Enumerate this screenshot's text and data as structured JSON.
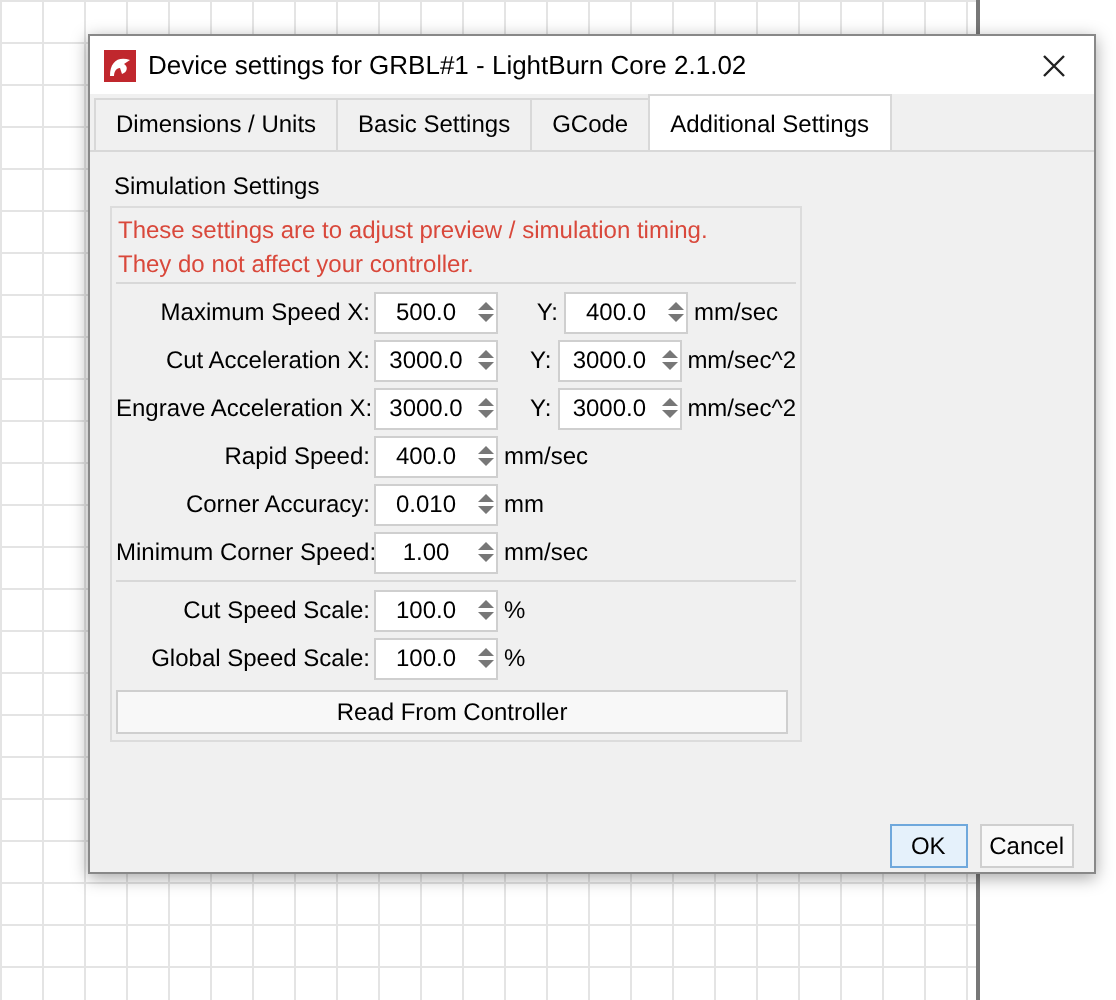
{
  "window": {
    "title": "Device settings for GRBL#1 - LightBurn Core 2.1.02"
  },
  "tabs": [
    {
      "label": "Dimensions / Units",
      "selected": false
    },
    {
      "label": "Basic Settings",
      "selected": false
    },
    {
      "label": "GCode",
      "selected": false
    },
    {
      "label": "Additional Settings",
      "selected": true
    }
  ],
  "group": {
    "title": "Simulation Settings",
    "note": [
      "These settings are to adjust preview / simulation timing.",
      "They do not affect your controller."
    ],
    "sections": [
      [
        {
          "kind": "xy",
          "label": "Maximum Speed X:",
          "value": "500.0",
          "y_label": "Y:",
          "y_value": "400.0",
          "unit": "mm/sec"
        },
        {
          "kind": "xy",
          "label": "Cut Acceleration X:",
          "value": "3000.0",
          "y_label": "Y:",
          "y_value": "3000.0",
          "unit": "mm/sec^2"
        },
        {
          "kind": "xy",
          "label": "Engrave Acceleration X:",
          "value": "3000.0",
          "y_label": "Y:",
          "y_value": "3000.0",
          "unit": "mm/sec^2"
        },
        {
          "kind": "single",
          "label": "Rapid Speed:",
          "value": "400.0",
          "unit": "mm/sec"
        },
        {
          "kind": "single",
          "label": "Corner Accuracy:",
          "value": "0.010",
          "unit": "mm"
        },
        {
          "kind": "single",
          "label": "Minimum Corner Speed:",
          "value": "1.00",
          "unit": "mm/sec"
        }
      ],
      [
        {
          "kind": "single",
          "label": "Cut Speed Scale:",
          "value": "100.0",
          "unit": "%"
        },
        {
          "kind": "single",
          "label": "Global Speed Scale:",
          "value": "100.0",
          "unit": "%"
        }
      ]
    ],
    "button": "Read From Controller"
  },
  "buttons": [
    {
      "label": "OK",
      "selected": true
    },
    {
      "label": "Cancel",
      "selected": false
    }
  ]
}
